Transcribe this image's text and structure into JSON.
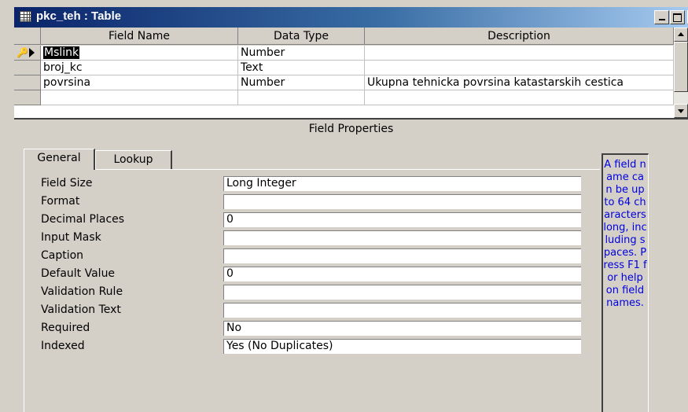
{
  "window": {
    "title": "pkc_teh : Table",
    "title_icon": "table-icon",
    "buttons": [
      "minimize",
      "maximize",
      "close"
    ],
    "close_glyph": "x"
  },
  "grid": {
    "columns": [
      "Field Name",
      "Data Type",
      "Description"
    ],
    "rows": [
      {
        "field_name": "Mslink",
        "data_type": "Number",
        "description": "",
        "primary_key": true,
        "current": true
      },
      {
        "field_name": "broj_kc",
        "data_type": "Text",
        "description": ""
      },
      {
        "field_name": "povrsina",
        "data_type": "Number",
        "description": "Ukupna tehnicka povrsina katastarskih cestica"
      },
      {
        "field_name": "",
        "data_type": "",
        "description": ""
      }
    ]
  },
  "field_properties": {
    "title": "Field Properties",
    "tabs": [
      "General",
      "Lookup"
    ],
    "active_tab": "General",
    "properties": [
      {
        "label": "Field Size",
        "value": "Long Integer"
      },
      {
        "label": "Format",
        "value": ""
      },
      {
        "label": "Decimal Places",
        "value": "0"
      },
      {
        "label": "Input Mask",
        "value": ""
      },
      {
        "label": "Caption",
        "value": ""
      },
      {
        "label": "Default Value",
        "value": "0"
      },
      {
        "label": "Validation Rule",
        "value": ""
      },
      {
        "label": "Validation Text",
        "value": ""
      },
      {
        "label": "Required",
        "value": "No"
      },
      {
        "label": "Indexed",
        "value": "Yes (No Duplicates)"
      }
    ]
  },
  "help": {
    "text": "A field name can be up to 64 characters long, including spaces. Press F1 for help on field names."
  },
  "colors": {
    "title_bar_start": "#0a246a",
    "title_bar_end": "#a6caf0",
    "help_text": "#0000e0",
    "selection_bg": "#000000",
    "window_face": "#d4d0c8"
  }
}
